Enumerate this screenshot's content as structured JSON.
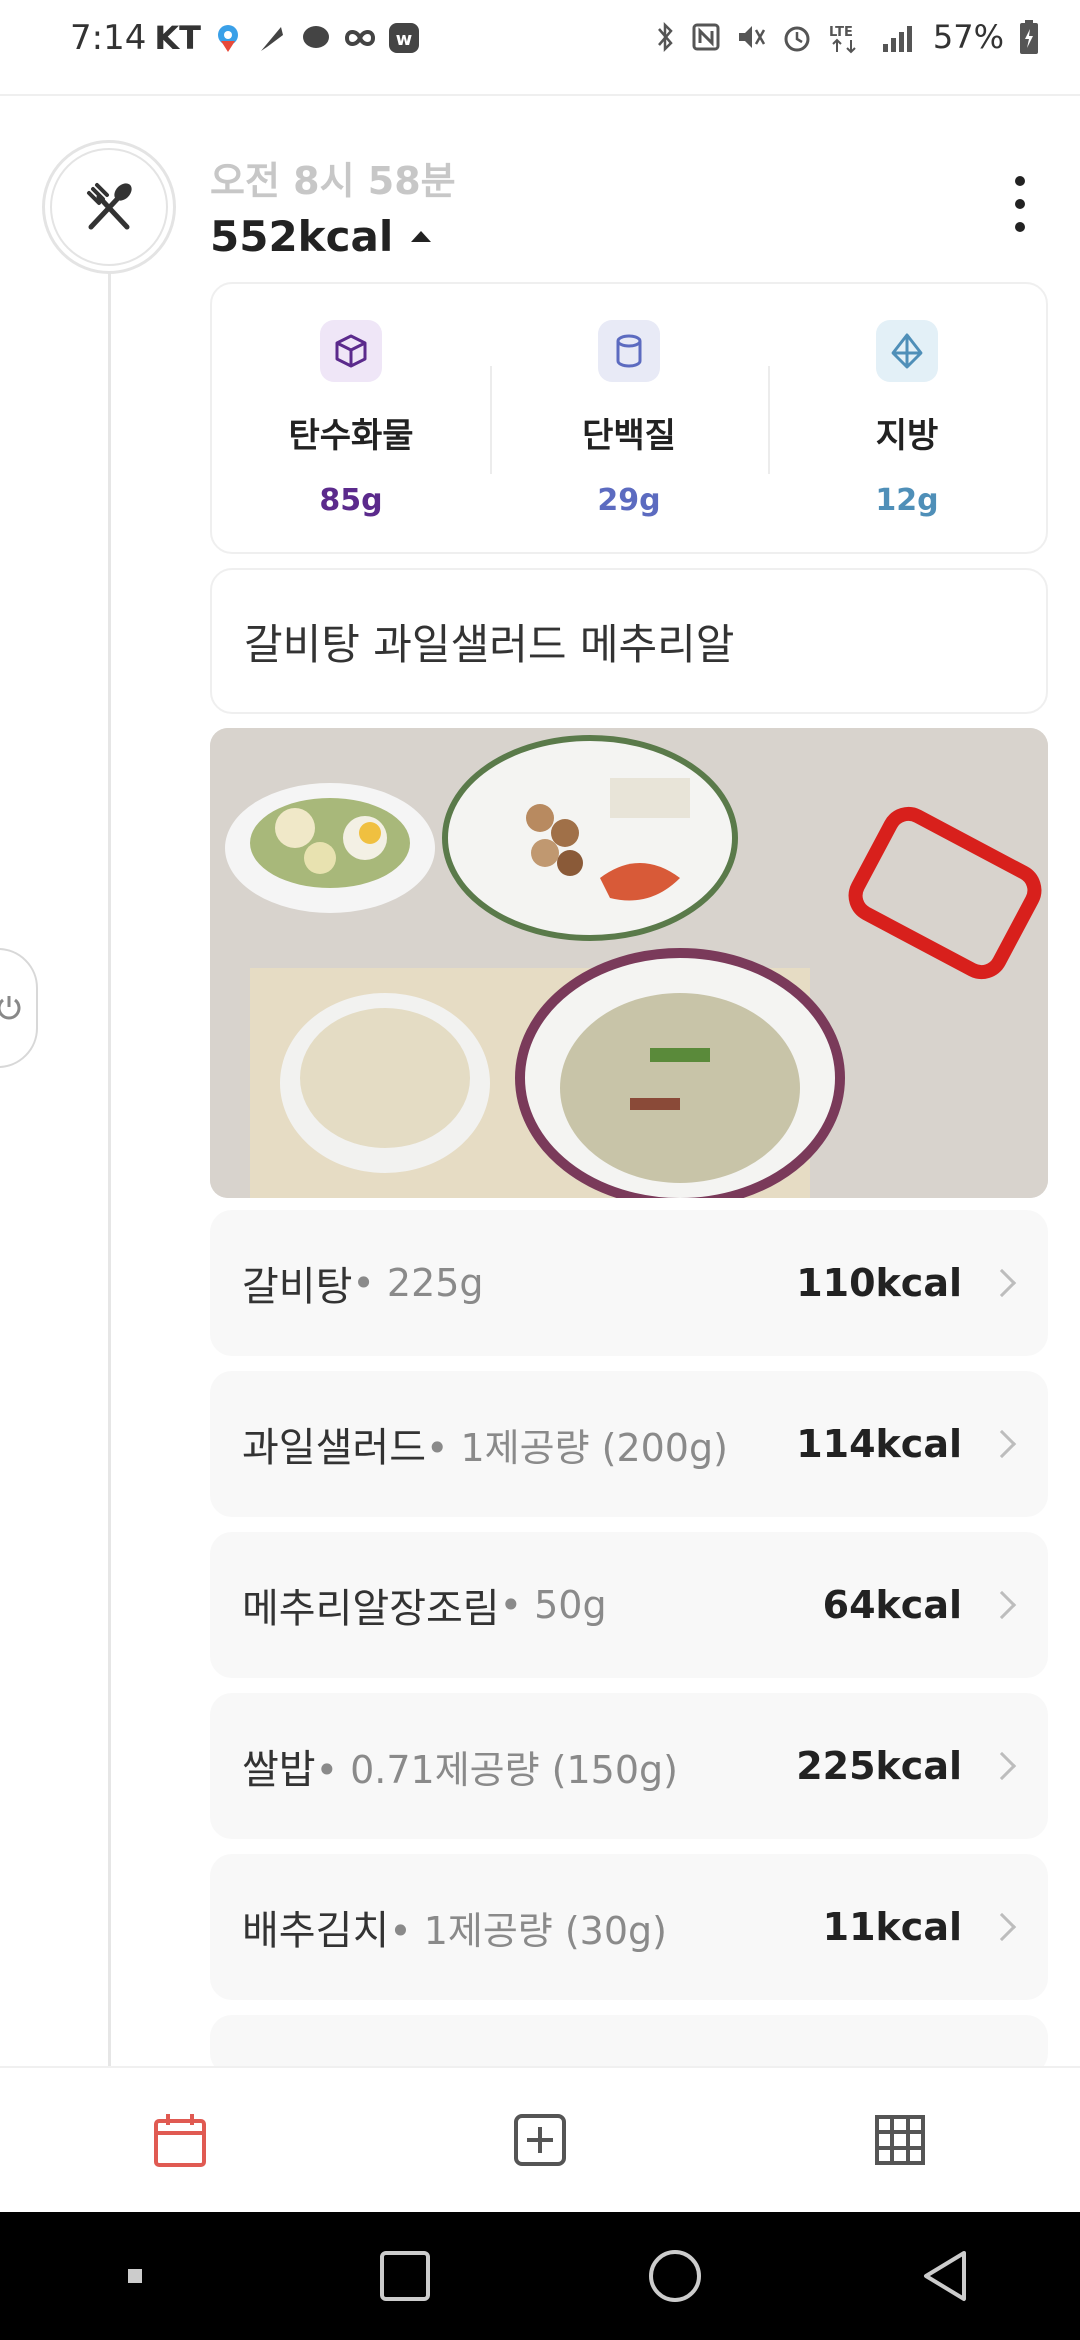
{
  "status_bar": {
    "time": "7:14",
    "carrier": "KT",
    "battery": "57%"
  },
  "meal": {
    "time": "오전 8시 58분",
    "kcal": "552kcal",
    "icon": "utensils-icon"
  },
  "macros": [
    {
      "name": "탄수화물",
      "value": "85g",
      "color": "#5b2a8c",
      "bg": "#efe6f7",
      "icon": "cube-icon"
    },
    {
      "name": "단백질",
      "value": "29g",
      "color": "#5c6bc0",
      "bg": "#e8eaf6",
      "icon": "cylinder-icon"
    },
    {
      "name": "지방",
      "value": "12g",
      "color": "#4f8fb8",
      "bg": "#e3f0f7",
      "icon": "diamond-icon"
    }
  ],
  "memo": "갈비탕 과일샐러드 메추리알",
  "foods": [
    {
      "name": "갈비탕",
      "qty": "• 225g",
      "kcal": "110kcal"
    },
    {
      "name": "과일샐러드",
      "qty": "• 1제공량 (200g)",
      "kcal": "114kcal"
    },
    {
      "name": "메추리알장조림",
      "qty": "• 50g",
      "kcal": "64kcal"
    },
    {
      "name": "쌀밥",
      "qty": "• 0.71제공량 (150g)",
      "kcal": "225kcal"
    },
    {
      "name": "배추김치",
      "qty": "• 1제공량 (30g)",
      "kcal": "11kcal"
    }
  ],
  "bottom_nav": [
    {
      "icon": "calendar-icon",
      "color": "#e05a52"
    },
    {
      "icon": "add-square-icon",
      "color": "#555555"
    },
    {
      "icon": "grid-icon",
      "color": "#555555"
    }
  ],
  "colors": {
    "accent": "#e05a52"
  }
}
